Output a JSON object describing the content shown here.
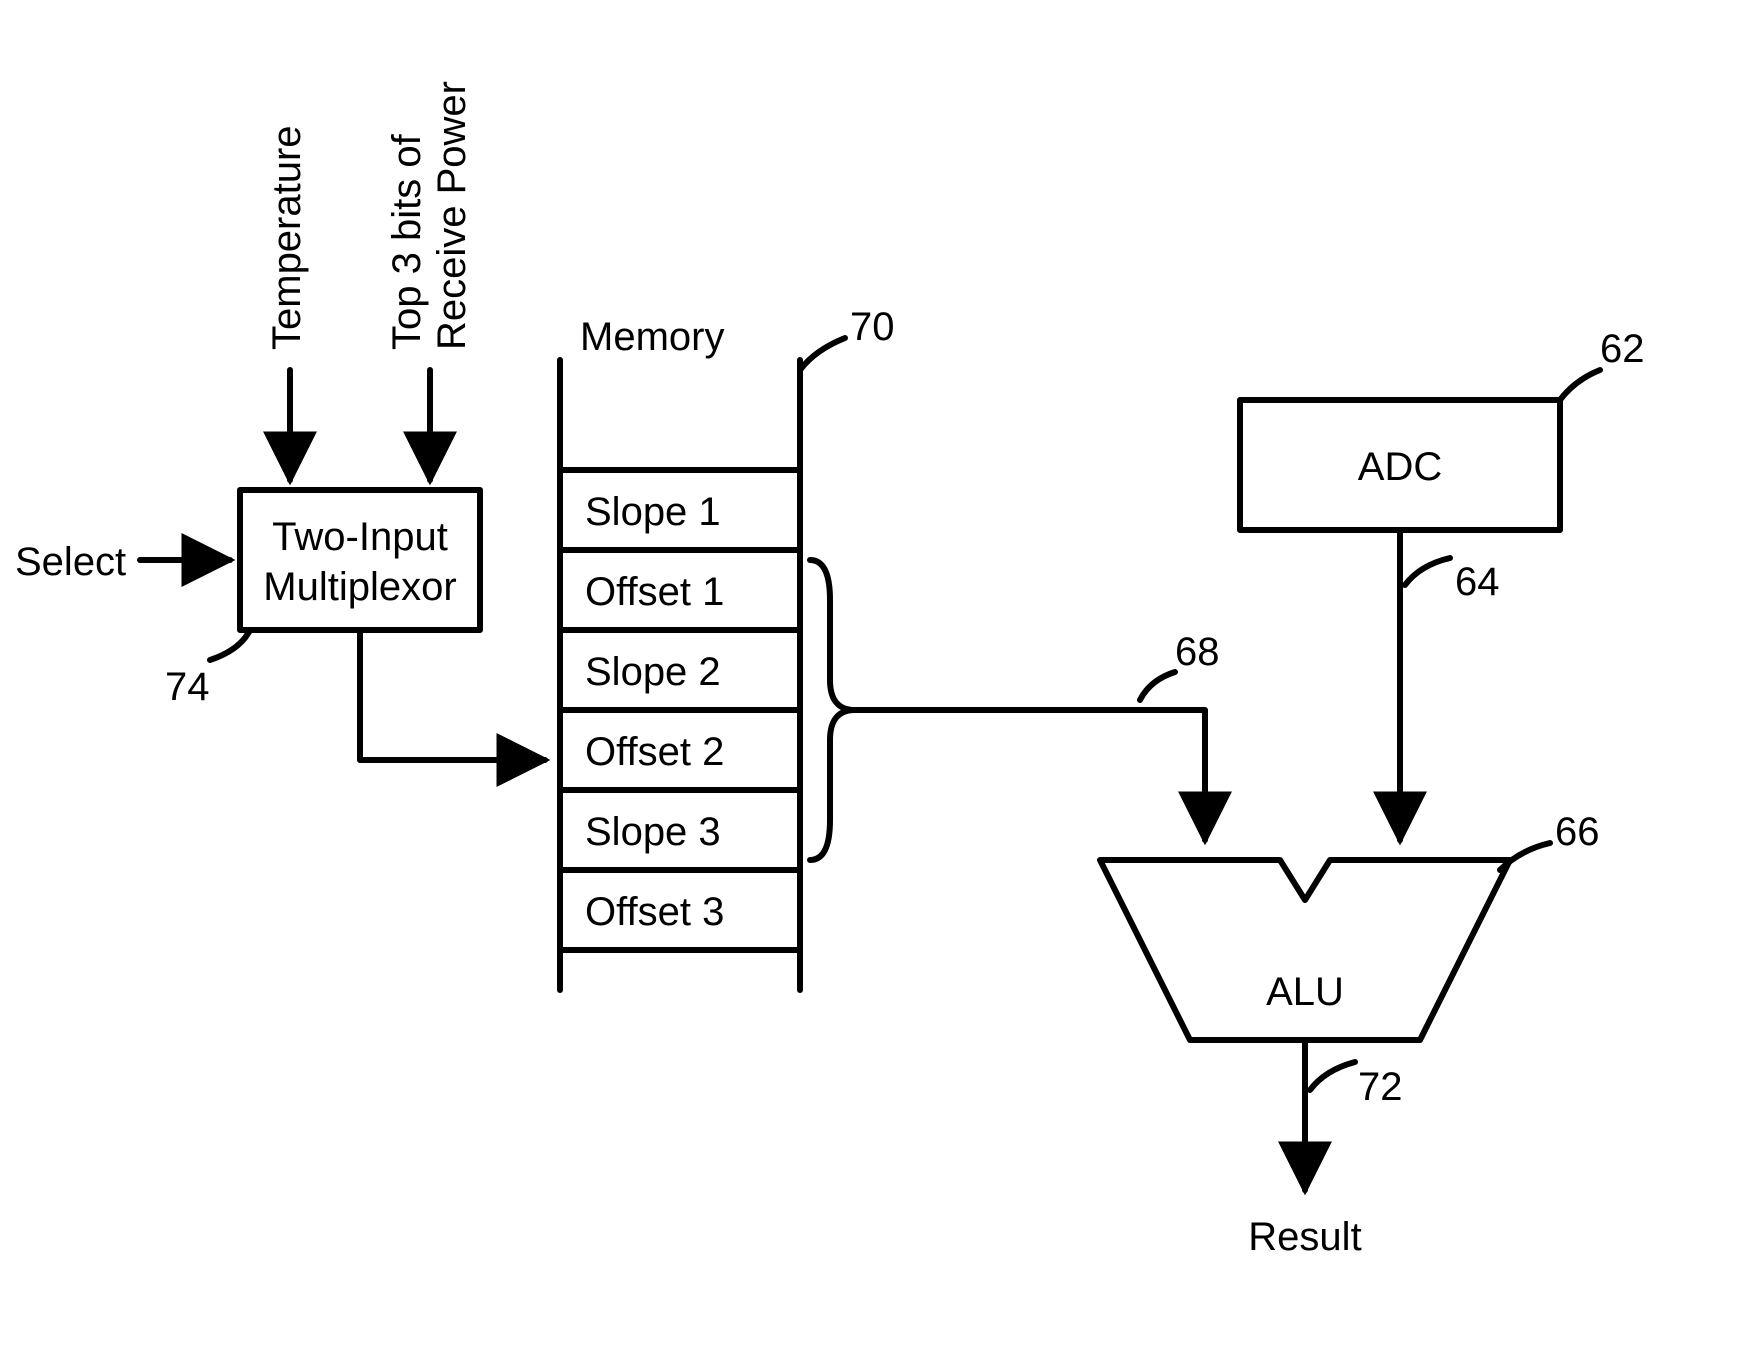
{
  "inputs": {
    "select": "Select",
    "temperature": "Temperature",
    "top3bits": "Top 3 bits of",
    "receive_power": "Receive Power"
  },
  "mux": {
    "line1": "Two-Input",
    "line2": "Multiplexor",
    "ref": "74"
  },
  "memory": {
    "title": "Memory",
    "ref": "70",
    "cells": [
      "Slope 1",
      "Offset 1",
      "Slope 2",
      "Offset 2",
      "Slope 3",
      "Offset 3"
    ],
    "bus_ref": "68"
  },
  "adc": {
    "label": "ADC",
    "ref": "62",
    "out_ref": "64"
  },
  "alu": {
    "label": "ALU",
    "ref": "66",
    "out_ref": "72",
    "result": "Result"
  }
}
